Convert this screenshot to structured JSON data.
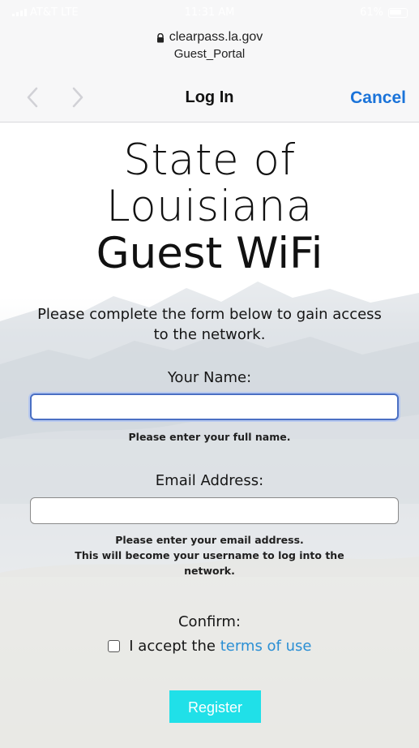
{
  "status_bar": {
    "carrier": "AT&T LTE",
    "time": "11:31 AM",
    "battery": "61%"
  },
  "browser": {
    "domain": "clearpass.la.gov",
    "page_name": "Guest_Portal",
    "nav_title": "Log In",
    "cancel_label": "Cancel",
    "back_icon": "chevron-left-icon",
    "forward_icon": "chevron-right-icon",
    "lock_icon": "lock-icon"
  },
  "form": {
    "title_line1": "State of",
    "title_line2": "Louisiana",
    "title_line3": "Guest WiFi",
    "intro_line1": "Please complete the form below to gain access",
    "intro_line2": "to the network.",
    "name_label": "Your Name:",
    "name_value": "",
    "name_help": "Please enter your full name.",
    "email_label": "Email Address:",
    "email_value": "",
    "email_help_line1": "Please enter your email address.",
    "email_help_line2": "This will become your username to log into the",
    "email_help_line3": "network.",
    "confirm_label": "Confirm:",
    "accept_prefix": "I accept the",
    "terms_link": "terms of use",
    "register_label": "Register",
    "accent_color": "#20e0e8",
    "link_color": "#2b8fd4"
  }
}
